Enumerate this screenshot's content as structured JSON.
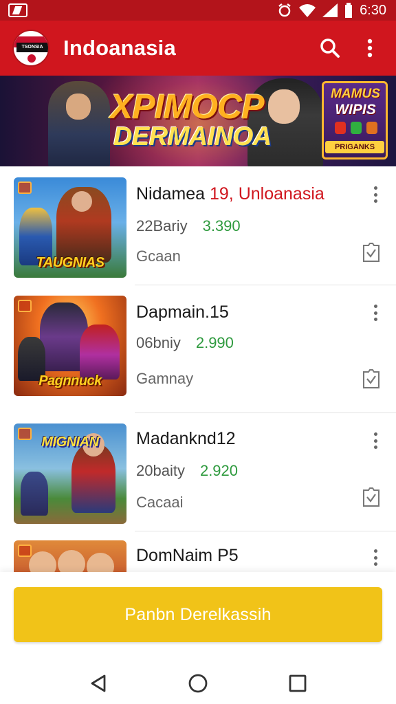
{
  "status_bar": {
    "time": "6:30"
  },
  "app_bar": {
    "logo_text": "TSONSIA",
    "title": "Indoanasia"
  },
  "banner": {
    "title_line1": "XPIMOCP",
    "title_line2": "DERMAINOA",
    "badge_line1": "MAMUS",
    "badge_line2": "WIPIS",
    "badge_line3": "PRIGANKS"
  },
  "items": [
    {
      "name": "Nidamea ",
      "name_accent": "19, Unloanasia",
      "meta": "22Bariy",
      "score": "3.390",
      "tag": "Gcaan",
      "thumb_logo": "TAUGNIAS"
    },
    {
      "name": "Dapmain.15",
      "name_accent": "",
      "meta": "06bniy",
      "score": "2.990",
      "tag": "Gamnay",
      "thumb_logo": "Pagnnuck"
    },
    {
      "name": "Madanknd12",
      "name_accent": "",
      "meta": "20baity",
      "score": "2.920",
      "tag": "Cacaai",
      "thumb_logo": "MIGNIAN"
    },
    {
      "name": "DomNaim P5",
      "name_accent": "",
      "meta": "",
      "score": "",
      "tag": "",
      "thumb_logo": ""
    }
  ],
  "cta": {
    "label": "Panbn Derelkassih"
  },
  "colors": {
    "app_bar": "#d0161e",
    "status_bar": "#b3141b",
    "cta": "#f1c318",
    "score": "#2e9a3e",
    "accent": "#d0161e"
  },
  "icons": [
    "notification-icon",
    "alarm-icon",
    "wifi-icon",
    "signal-icon",
    "battery-icon",
    "search-icon",
    "more-vert-icon",
    "bookmark-check-icon",
    "back-icon",
    "home-icon",
    "recents-icon"
  ]
}
